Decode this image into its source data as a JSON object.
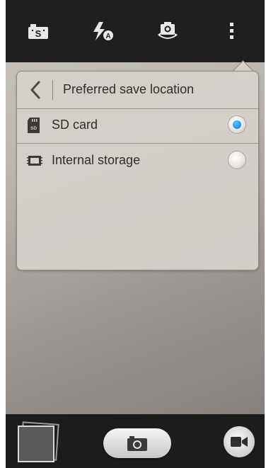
{
  "topbar": {
    "items": [
      {
        "icon": "shooting-mode-icon"
      },
      {
        "icon": "flash-auto-icon"
      },
      {
        "icon": "switch-camera-icon"
      },
      {
        "icon": "more-options-icon"
      }
    ]
  },
  "panel": {
    "title": "Preferred save location",
    "options": [
      {
        "label": "SD card",
        "icon": "sd-card-icon",
        "selected": true
      },
      {
        "label": "Internal storage",
        "icon": "chip-icon",
        "selected": false
      }
    ]
  },
  "bottombar": {
    "thumbnail": "gallery-thumbnail",
    "shutter_icon": "camera-icon",
    "record_icon": "video-camera-icon"
  },
  "colors": {
    "accent": "#1f8fe0",
    "bar": "#1f1f1f"
  }
}
